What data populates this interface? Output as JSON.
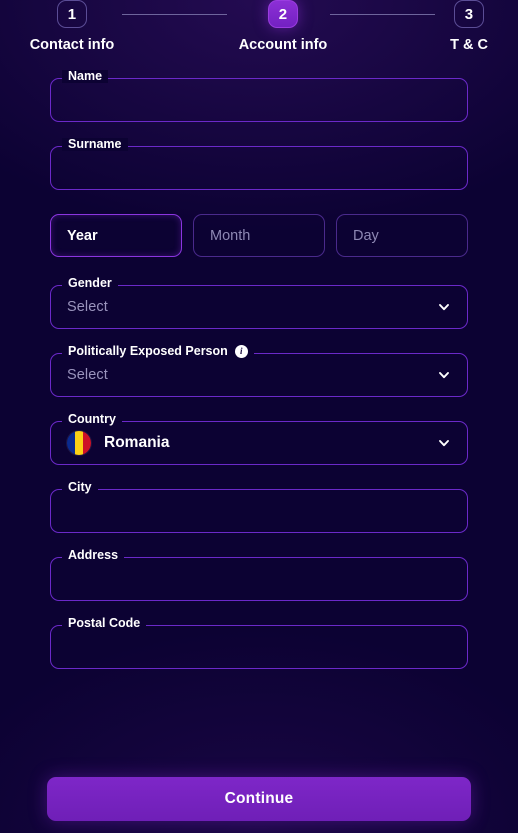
{
  "stepper": {
    "steps": [
      {
        "number": "1",
        "label": "Contact info",
        "state": "idle"
      },
      {
        "number": "2",
        "label": "Account info",
        "state": "active"
      },
      {
        "number": "3",
        "label": "T & C",
        "state": "idle"
      }
    ]
  },
  "form": {
    "name": {
      "label": "Name",
      "value": ""
    },
    "surname": {
      "label": "Surname",
      "value": ""
    },
    "birthdate": {
      "year": {
        "placeholder": "Year",
        "value": "Year",
        "state": "filled"
      },
      "month": {
        "placeholder": "Month",
        "value": "Month",
        "state": "empty"
      },
      "day": {
        "placeholder": "Day",
        "value": "Day",
        "state": "empty"
      }
    },
    "gender": {
      "label": "Gender",
      "value": "Select",
      "icon": "chevron-down-icon"
    },
    "pep": {
      "label": "Politically Exposed Person",
      "value": "Select",
      "info_icon": "info-icon",
      "info_glyph": "i",
      "icon": "chevron-down-icon"
    },
    "country": {
      "label": "Country",
      "value": "Romania",
      "flag": "romania-flag-icon",
      "flag_colors": [
        "#0a2a8f",
        "#fcd116",
        "#ce1126"
      ],
      "icon": "chevron-down-icon"
    },
    "city": {
      "label": "City",
      "value": ""
    },
    "address": {
      "label": "Address",
      "value": ""
    },
    "postal_code": {
      "label": "Postal Code",
      "value": ""
    }
  },
  "actions": {
    "continue_label": "Continue"
  },
  "colors": {
    "background": "#0c0233",
    "accent": "#7e27c8",
    "field_border": "#6b29c9",
    "active_border": "#8b35e0",
    "placeholder_text": "#9a94bd"
  }
}
